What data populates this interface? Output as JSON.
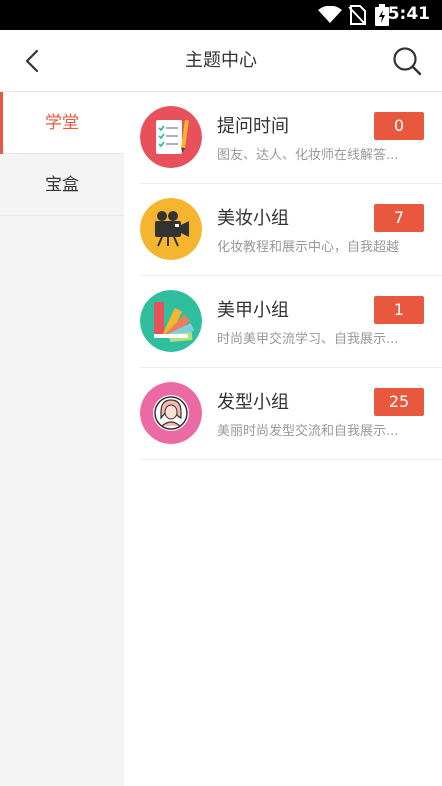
{
  "statusbar": {
    "time": "5:41"
  },
  "header": {
    "title": "主题中心"
  },
  "sidebar": {
    "items": [
      {
        "label": "学堂",
        "active": true
      },
      {
        "label": "宝盒",
        "active": false
      }
    ]
  },
  "topics": [
    {
      "name": "提问时间",
      "desc": "图友、达人、化妆师在线解答...",
      "count": "0",
      "icon": "question-list-icon",
      "color": "#e8505b"
    },
    {
      "name": "美妆小组",
      "desc": "化妆教程和展示中心，自我超越",
      "count": "7",
      "icon": "video-camera-icon",
      "color": "#f5b52e"
    },
    {
      "name": "美甲小组",
      "desc": "时尚美甲交流学习、自我展示...",
      "count": "1",
      "icon": "nail-palette-icon",
      "color": "#2fbf9e"
    },
    {
      "name": "发型小组",
      "desc": "美丽时尚发型交流和自我展示...",
      "count": "25",
      "icon": "hair-avatar-icon",
      "color": "#ec6aa3"
    }
  ]
}
